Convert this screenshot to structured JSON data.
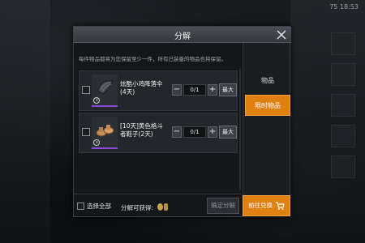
{
  "status_text": "75  18:53",
  "dialog": {
    "title": "分解",
    "notice": "每件物品都将为您保留至少一件，所有已装备的物品也将保留。"
  },
  "items": [
    {
      "name": "炫酷小鸡降落伞(4天)",
      "qty": "0/1",
      "max_label": "最大"
    },
    {
      "name": "[10天]黄色格斗者鞋子(2天)",
      "qty": "0/1",
      "max_label": "最大"
    }
  ],
  "tabs": [
    {
      "label": "物品"
    },
    {
      "label": "限时物品"
    }
  ],
  "footer": {
    "select_all": "选择全部",
    "gain": "分解可获得:",
    "confirm": "确定分解",
    "exchange": "前往兑换"
  },
  "colors": {
    "accent": "#e07f12",
    "rarity_purple": "#8a4cd6"
  }
}
